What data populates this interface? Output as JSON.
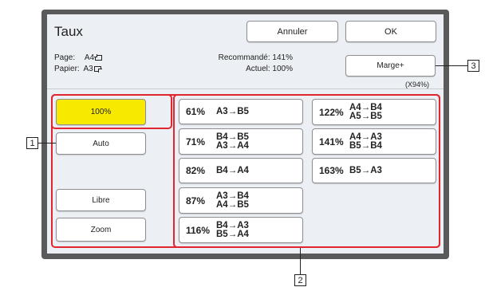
{
  "dialog": {
    "title": "Taux",
    "cancel_label": "Annuler",
    "ok_label": "OK"
  },
  "info": {
    "page_label": "Page:",
    "page_size": "A4",
    "paper_label": "Papier:",
    "paper_size": "A3",
    "recommended_label": "Recommandé:",
    "recommended_value": "141%",
    "current_label": "Actuel:",
    "current_value": "100%"
  },
  "margin": {
    "button_label": "Marge+",
    "factor": "(X94%)"
  },
  "left_buttons": {
    "full": "100%",
    "auto": "Auto",
    "free": "Libre",
    "zoom": "Zoom"
  },
  "ratios": [
    {
      "pct": "61%",
      "line1": "A3→B5",
      "line2": ""
    },
    {
      "pct": "71%",
      "line1": "B4→B5",
      "line2": "A3→A4"
    },
    {
      "pct": "82%",
      "line1": "B4→A4",
      "line2": ""
    },
    {
      "pct": "87%",
      "line1": "A3→B4",
      "line2": "A4→B5"
    },
    {
      "pct": "116%",
      "line1": "B4→A3",
      "line2": "B5→A4"
    },
    {
      "pct": "122%",
      "line1": "A4→B4",
      "line2": "A5→B5"
    },
    {
      "pct": "141%",
      "line1": "A4→A3",
      "line2": "B5→B4"
    },
    {
      "pct": "163%",
      "line1": "B5→A3",
      "line2": ""
    }
  ],
  "callouts": {
    "c1": "1",
    "c2": "2",
    "c3": "3"
  },
  "colors": {
    "selected": "#f7ea00",
    "highlight": "#e2262f",
    "bezel": "#5a5a5a"
  }
}
